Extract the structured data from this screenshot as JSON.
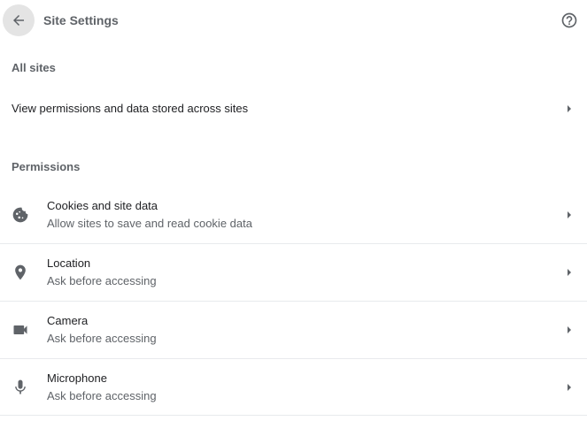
{
  "header": {
    "back_icon": "arrow-back-icon",
    "title": "Site Settings",
    "help_icon": "help-circle-icon"
  },
  "all_sites": {
    "section_label": "All sites",
    "row_label": "View permissions and data stored across sites",
    "row_icon": "chevron-right-icon"
  },
  "permissions": {
    "section_label": "Permissions",
    "items": [
      {
        "icon": "cookie-icon",
        "title": "Cookies and site data",
        "subtitle": "Allow sites to save and read cookie data"
      },
      {
        "icon": "location-pin-icon",
        "title": "Location",
        "subtitle": "Ask before accessing"
      },
      {
        "icon": "camera-icon",
        "title": "Camera",
        "subtitle": "Ask before accessing"
      },
      {
        "icon": "microphone-icon",
        "title": "Microphone",
        "subtitle": "Ask before accessing"
      }
    ]
  },
  "colors": {
    "icon": "#5f6368",
    "back_button_bg": "#e4e4e4",
    "divider": "#e8eaed",
    "primary_text": "#202124",
    "secondary_text": "#5f6368"
  }
}
